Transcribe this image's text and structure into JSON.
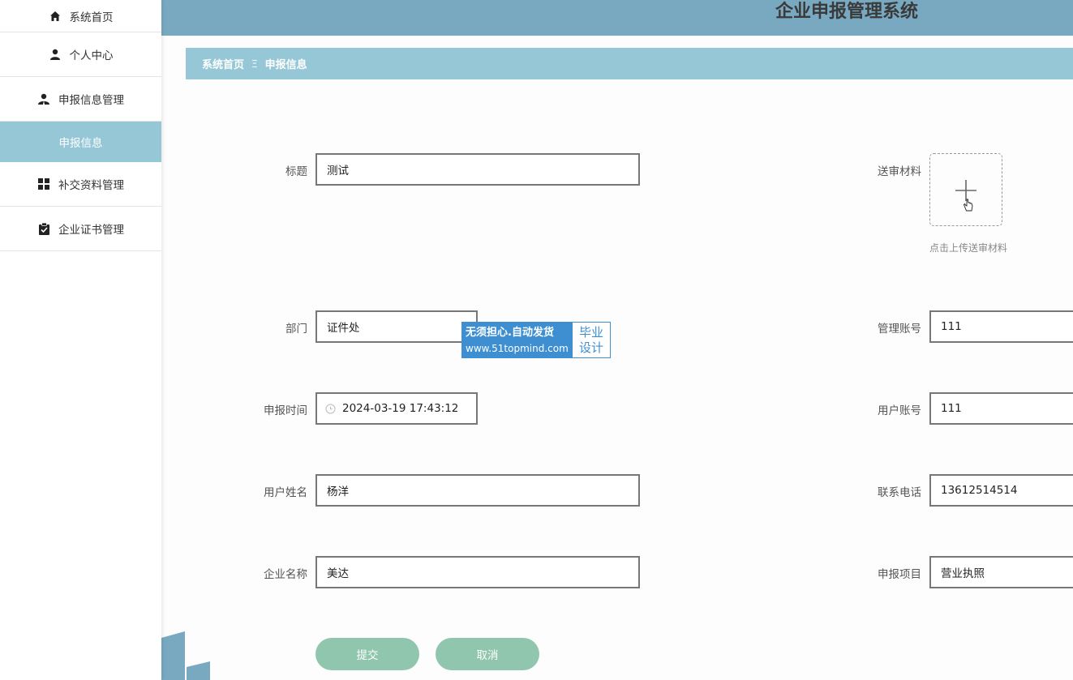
{
  "app": {
    "title": "企业申报管理系统"
  },
  "sidebar": {
    "items": [
      {
        "label": "系统首页",
        "icon": "home-icon"
      },
      {
        "label": "个人中心",
        "icon": "user-icon"
      },
      {
        "label": "申报信息管理",
        "icon": "user-group-icon"
      },
      {
        "label": "补交资料管理",
        "icon": "grid-icon"
      },
      {
        "label": "企业证书管理",
        "icon": "clipboard-check-icon"
      }
    ],
    "active_sub": "申报信息"
  },
  "breadcrumb": {
    "home": "系统首页",
    "separator": "Ξ",
    "current": "申报信息"
  },
  "form": {
    "title": {
      "label": "标题",
      "value": "测试"
    },
    "department": {
      "label": "部门",
      "value": "证件处"
    },
    "report_time": {
      "label": "申报时间",
      "value": "2024-03-19 17:43:12"
    },
    "user_name": {
      "label": "用户姓名",
      "value": "杨洋"
    },
    "company": {
      "label": "企业名称",
      "value": "美达"
    },
    "material": {
      "label": "送审材料",
      "hint": "点击上传送审材料"
    },
    "admin_account": {
      "label": "管理账号",
      "value": "111"
    },
    "user_account": {
      "label": "用户账号",
      "value": "111"
    },
    "phone": {
      "label": "联系电话",
      "value": "13612514514"
    },
    "project": {
      "label": "申报项目",
      "value": "营业执照"
    },
    "submit_label": "提交",
    "cancel_label": "取消"
  },
  "watermark": {
    "line1": "无须担心.自动发货",
    "line2": "www.51topmind.com",
    "badge_line1": "毕业",
    "badge_line2": "设计"
  },
  "colors": {
    "topbar": "#78a9c0",
    "accent": "#95c7d6",
    "button": "#8fc6ad",
    "watermark": "#3d8fd1"
  }
}
